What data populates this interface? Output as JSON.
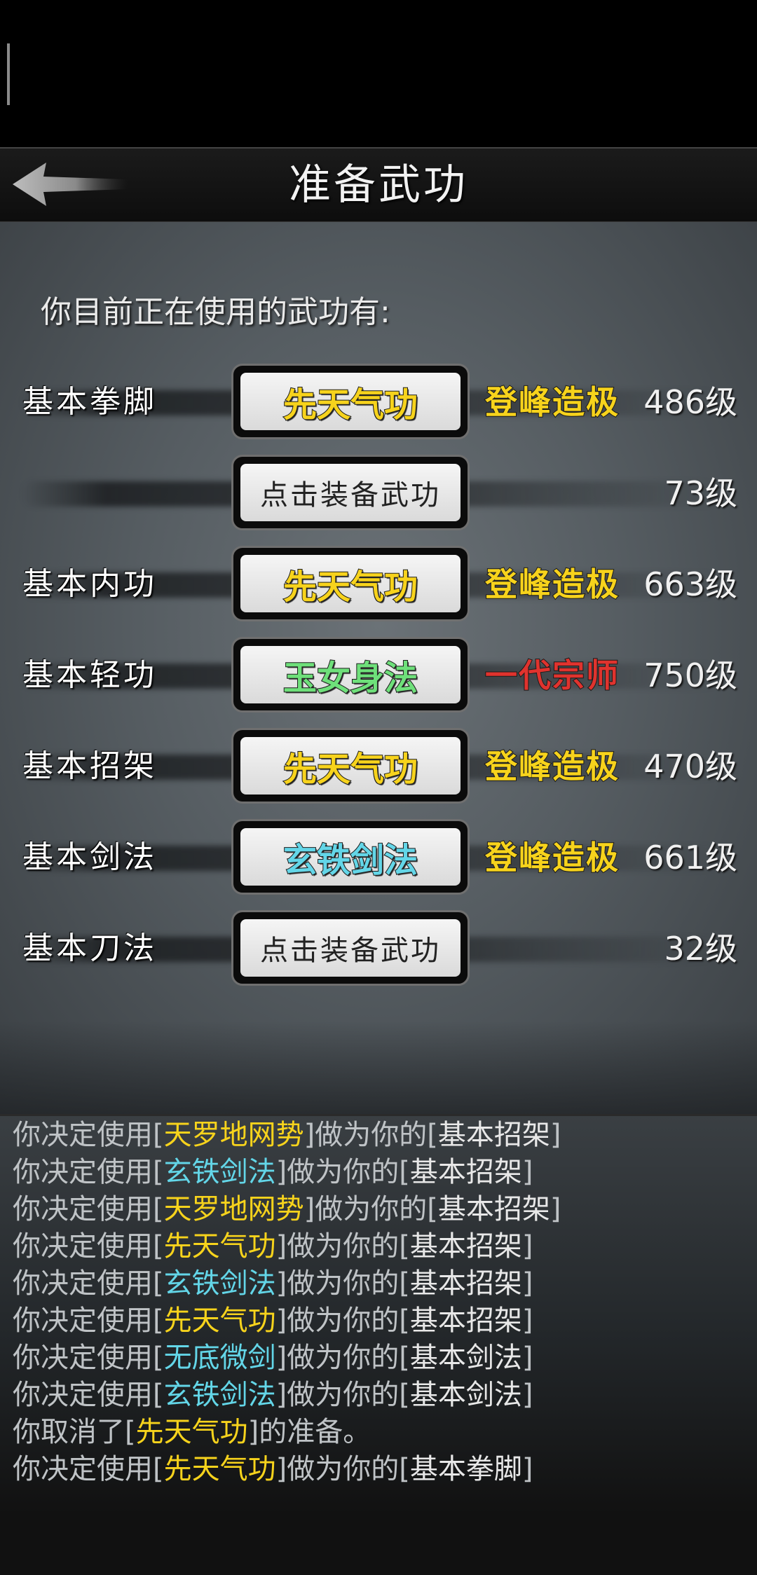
{
  "header": {
    "title": "准备武功"
  },
  "intro": "你目前正在使用的武功有:",
  "colors": {
    "yellow": "#f7d31c",
    "green": "#6ee07a",
    "cyan": "#63d6e8",
    "red": "#e0332e"
  },
  "rows": [
    {
      "slot": "基本拳脚",
      "skill": "先天气功",
      "skill_color": "#f7d31c",
      "mastery": "登峰造极",
      "mastery_color": "#f7d31c",
      "level": "486级"
    },
    {
      "slot": "",
      "skill": "点击装备武功",
      "skill_color": "",
      "mastery": "",
      "mastery_color": "",
      "level": "73级"
    },
    {
      "slot": "基本内功",
      "skill": "先天气功",
      "skill_color": "#f7d31c",
      "mastery": "登峰造极",
      "mastery_color": "#f7d31c",
      "level": "663级"
    },
    {
      "slot": "基本轻功",
      "skill": "玉女身法",
      "skill_color": "#6ee07a",
      "mastery": "一代宗师",
      "mastery_color": "#e0332e",
      "level": "750级"
    },
    {
      "slot": "基本招架",
      "skill": "先天气功",
      "skill_color": "#f7d31c",
      "mastery": "登峰造极",
      "mastery_color": "#f7d31c",
      "level": "470级"
    },
    {
      "slot": "基本剑法",
      "skill": "玄铁剑法",
      "skill_color": "#63d6e8",
      "mastery": "登峰造极",
      "mastery_color": "#f7d31c",
      "level": "661级"
    },
    {
      "slot": "基本刀法",
      "skill": "点击装备武功",
      "skill_color": "",
      "mastery": "",
      "mastery_color": "",
      "level": "32级"
    }
  ],
  "log": [
    {
      "pre": "你决定使用[",
      "skill": "天罗地网势",
      "mid": "]做为你的[",
      "slot": "基本招架",
      "post": "]",
      "cyan": false
    },
    {
      "pre": "你决定使用[",
      "skill": "玄铁剑法",
      "mid": "]做为你的[",
      "slot": "基本招架",
      "post": "]",
      "cyan": true
    },
    {
      "pre": "你决定使用[",
      "skill": "天罗地网势",
      "mid": "]做为你的[",
      "slot": "基本招架",
      "post": "]",
      "cyan": false
    },
    {
      "pre": "你决定使用[",
      "skill": "先天气功",
      "mid": "]做为你的[",
      "slot": "基本招架",
      "post": "]",
      "cyan": false
    },
    {
      "pre": "你决定使用[",
      "skill": "玄铁剑法",
      "mid": "]做为你的[",
      "slot": "基本招架",
      "post": "]",
      "cyan": true
    },
    {
      "pre": "你决定使用[",
      "skill": "先天气功",
      "mid": "]做为你的[",
      "slot": "基本招架",
      "post": "]",
      "cyan": false
    },
    {
      "pre": "你决定使用[",
      "skill": "无底微剑",
      "mid": "]做为你的[",
      "slot": "基本剑法",
      "post": "]",
      "cyan": true
    },
    {
      "pre": "你决定使用[",
      "skill": "玄铁剑法",
      "mid": "]做为你的[",
      "slot": "基本剑法",
      "post": "]",
      "cyan": true
    },
    {
      "pre": "你取消了[",
      "skill": "先天气功",
      "mid": "]的准备。",
      "slot": "",
      "post": "",
      "cyan": false
    },
    {
      "pre": "你决定使用[",
      "skill": "先天气功",
      "mid": "]做为你的[",
      "slot": "基本拳脚",
      "post": "]",
      "cyan": false
    }
  ]
}
